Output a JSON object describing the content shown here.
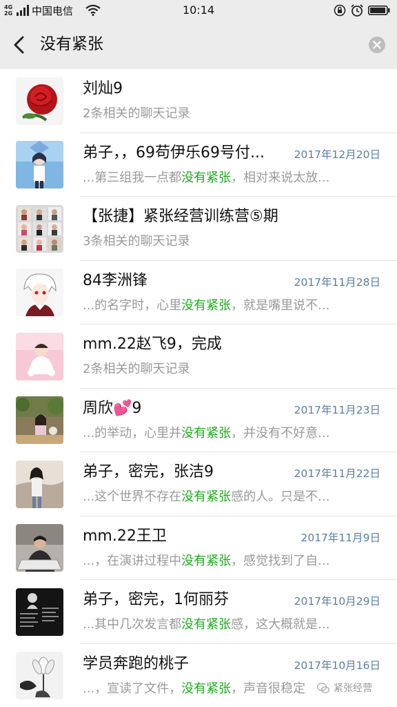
{
  "status_bar": {
    "network": "4G 2G",
    "carrier": "中国电信",
    "time": "10:14"
  },
  "search": {
    "query": "没有紧张"
  },
  "results": [
    {
      "name": "刘灿9",
      "date": "",
      "snippet_pre": "2条相关的聊天记录",
      "highlight": "",
      "snippet_post": "",
      "avatar": "red-rose"
    },
    {
      "name": "弟子，，69苟伊乐69号付...",
      "date": "2017年12月20日",
      "snippet_pre": "...第三组我一点都",
      "highlight": "没有紧张",
      "snippet_post": "，相对来说太放...",
      "avatar": "anime-girl"
    },
    {
      "name": "【张捷】紧张经营训练营⑤期",
      "date": "",
      "snippet_pre": "3条相关的聊天记录",
      "highlight": "",
      "snippet_post": "",
      "avatar": "group-grid"
    },
    {
      "name": "84李洲锋",
      "date": "2017年11月28日",
      "snippet_pre": "...的名字时，心里",
      "highlight": "没有紧张",
      "snippet_post": "，就是嘴里说不...",
      "avatar": "anime-white-hair"
    },
    {
      "name": "mm.22赵飞9，完成",
      "date": "",
      "snippet_pre": "2条相关的聊天记录",
      "highlight": "",
      "snippet_post": "",
      "avatar": "baby-pink"
    },
    {
      "name": "周欣💕9",
      "date": "2017年11月23日",
      "snippet_pre": "...的举动，心里并",
      "highlight": "没有紧张",
      "snippet_post": "，并没有不好意...",
      "avatar": "girl-plants"
    },
    {
      "name": "弟子，密完，张洁9",
      "date": "2017年11月22日",
      "snippet_pre": "...这个世界不存在",
      "highlight": "没有紧张",
      "snippet_post": "感的人。只是不...",
      "avatar": "woman-outdoor"
    },
    {
      "name": "mm.22王卫",
      "date": "2017年11月9日",
      "snippet_pre": "...，在演讲过程中",
      "highlight": "没有紧张",
      "snippet_post": "，感觉找到了自...",
      "avatar": "man-laptop"
    },
    {
      "name": "弟子，密完，1何丽芬",
      "date": "2017年10月29日",
      "snippet_pre": "...其中几次发言都",
      "highlight": "没有紧张",
      "snippet_post": "感，这大概就是...",
      "avatar": "dark-text"
    },
    {
      "name": "学员奔跑的桃子",
      "date": "2017年10月16日",
      "snippet_pre": "...，宣读了文件，",
      "highlight": "没有紧张",
      "snippet_post": "，声音很稳定",
      "avatar": "white-flower"
    }
  ],
  "watermark": {
    "text": "紧张经营"
  },
  "colors": {
    "highlight": "#1aad19",
    "date": "#5a7ea6",
    "header_bg": "#ececec"
  }
}
